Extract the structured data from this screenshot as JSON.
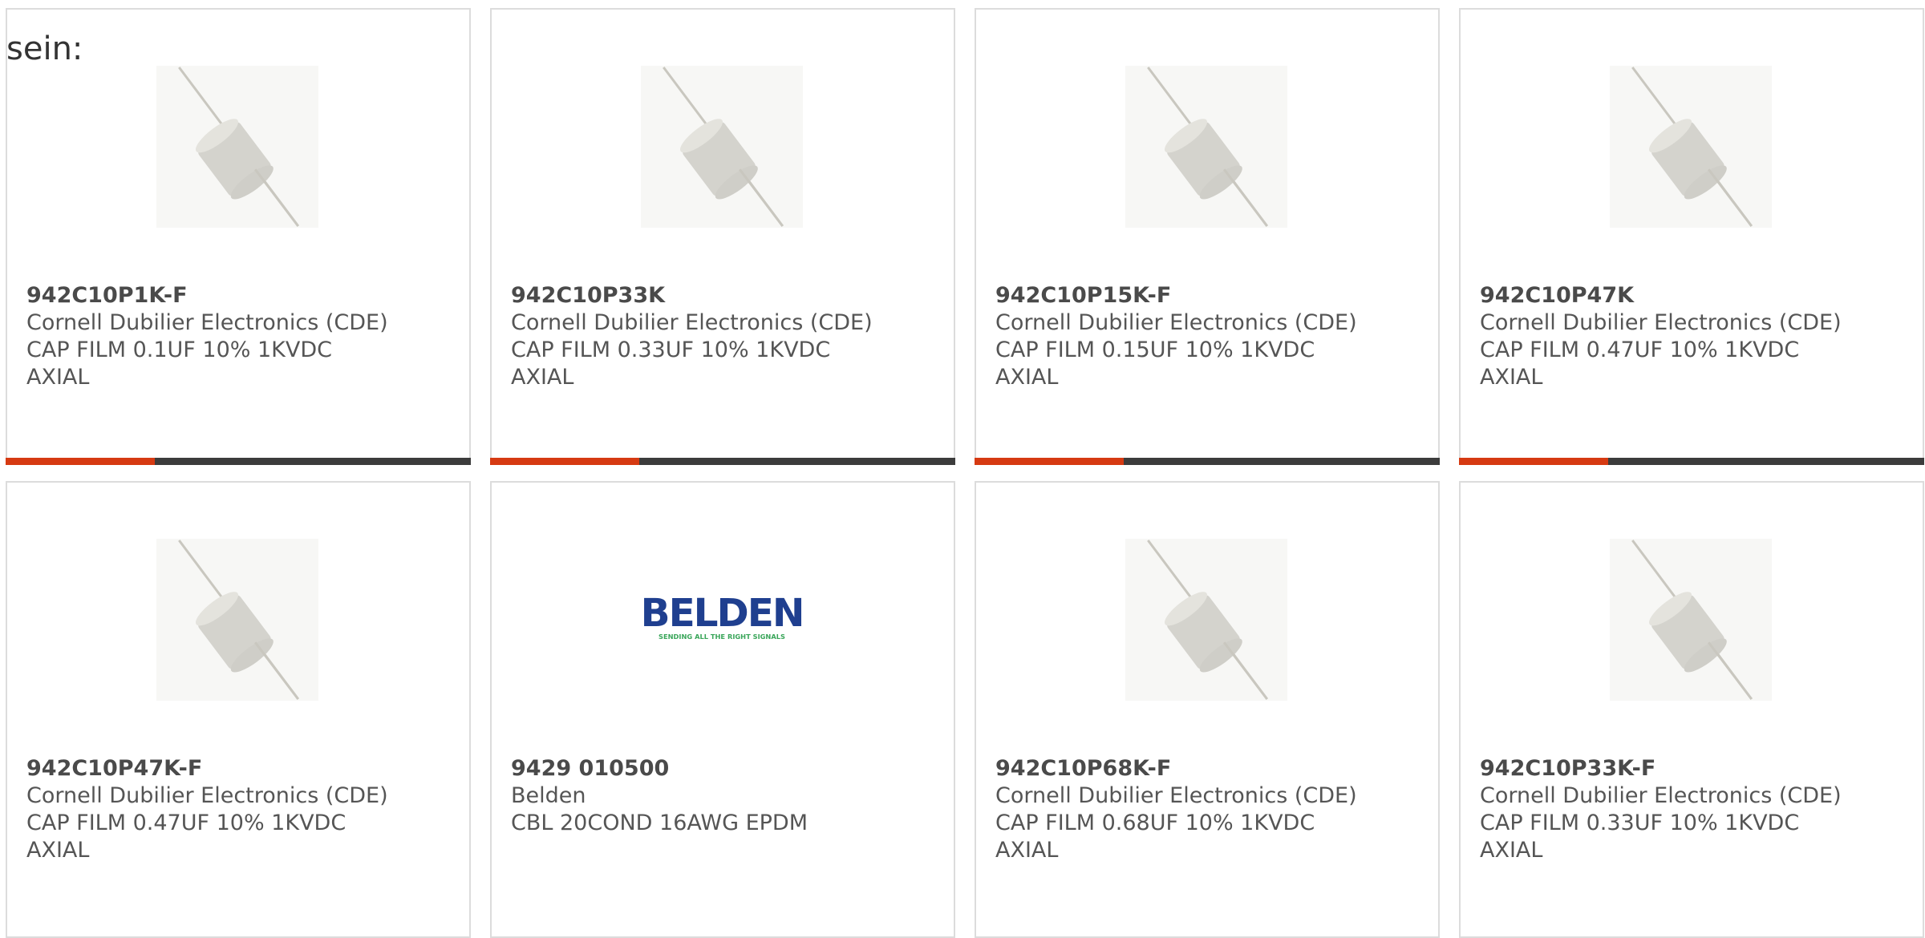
{
  "intro_text": "sein:",
  "colors": {
    "accent": "#d63a12",
    "bar_track": "#3c3c3c",
    "card_border": "#dcdcdc",
    "text": "#555555"
  },
  "products": [
    {
      "part_number": "942C10P1K-F",
      "manufacturer": "Cornell Dubilier Electronics (CDE)",
      "description_line1": "CAP FILM 0.1UF 10% 1KVDC",
      "description_line2": "AXIAL",
      "image_icon": "axial-capacitor-icon",
      "progress_fraction": 0.32
    },
    {
      "part_number": "942C10P33K",
      "manufacturer": "Cornell Dubilier Electronics (CDE)",
      "description_line1": "CAP FILM 0.33UF 10% 1KVDC",
      "description_line2": "AXIAL",
      "image_icon": "axial-capacitor-icon",
      "progress_fraction": 0.32
    },
    {
      "part_number": "942C10P15K-F",
      "manufacturer": "Cornell Dubilier Electronics (CDE)",
      "description_line1": "CAP FILM 0.15UF 10% 1KVDC",
      "description_line2": "AXIAL",
      "image_icon": "axial-capacitor-icon",
      "progress_fraction": 0.32
    },
    {
      "part_number": "942C10P47K",
      "manufacturer": "Cornell Dubilier Electronics (CDE)",
      "description_line1": "CAP FILM 0.47UF 10% 1KVDC",
      "description_line2": "AXIAL",
      "image_icon": "axial-capacitor-icon",
      "progress_fraction": 0.32
    },
    {
      "part_number": "942C10P47K-F",
      "manufacturer": "Cornell Dubilier Electronics (CDE)",
      "description_line1": "CAP FILM 0.47UF 10% 1KVDC",
      "description_line2": "AXIAL",
      "image_icon": "axial-capacitor-icon"
    },
    {
      "part_number": "9429 010500",
      "manufacturer": "Belden",
      "description_line1": "CBL 20COND 16AWG EPDM",
      "description_line2": "",
      "image_icon": "belden-logo",
      "logo_text": "BELDEN",
      "logo_tagline": "SENDING ALL THE RIGHT SIGNALS"
    },
    {
      "part_number": "942C10P68K-F",
      "manufacturer": "Cornell Dubilier Electronics (CDE)",
      "description_line1": "CAP FILM 0.68UF 10% 1KVDC",
      "description_line2": "AXIAL",
      "image_icon": "axial-capacitor-icon"
    },
    {
      "part_number": "942C10P33K-F",
      "manufacturer": "Cornell Dubilier Electronics (CDE)",
      "description_line1": "CAP FILM 0.33UF 10% 1KVDC",
      "description_line2": "AXIAL",
      "image_icon": "axial-capacitor-icon"
    }
  ]
}
